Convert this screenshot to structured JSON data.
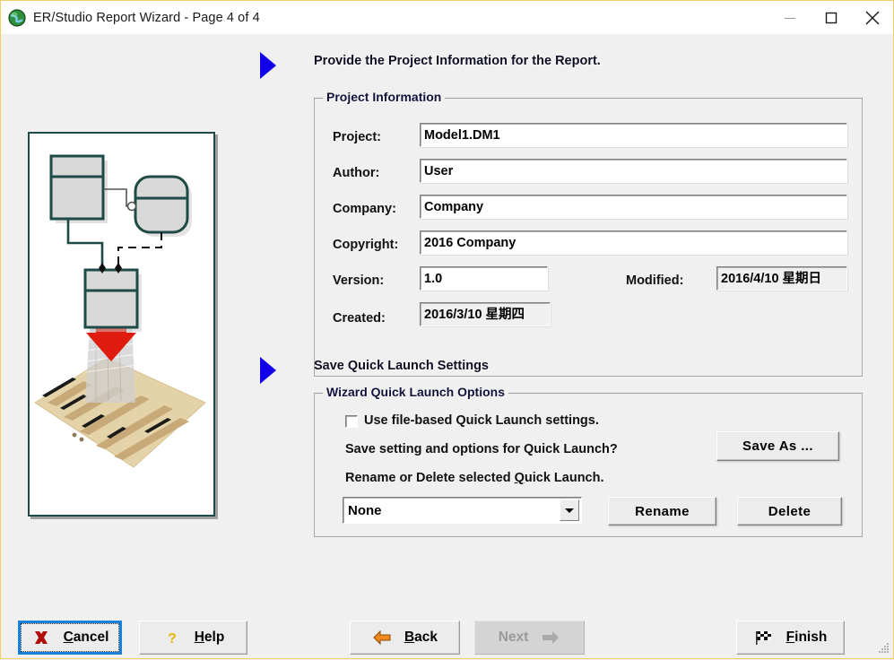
{
  "window": {
    "title": "ER/Studio Report Wizard - Page 4 of 4",
    "icon": "globe-icon",
    "minimize_label": "Minimize",
    "maximize_label": "Maximize",
    "close_label": "Close",
    "accent_border_color": "#f2cf6b",
    "titlebar_bg": "#ffffff",
    "client_bg": "#f0f0f0"
  },
  "illustration": {
    "name": "er-model-to-report-illustration",
    "colors": {
      "entity_border": "#1e4a47",
      "entity_fill": "#d5d5d5",
      "arrow": "#e02020",
      "page": "#e2ceа0"
    }
  },
  "section_project": {
    "heading": "Provide the Project Information for the Report.",
    "bullet_icon": "blue-triangle-bullet-icon",
    "group_title": "Project Information",
    "fields": [
      {
        "label": "Project:",
        "value": "Model1.DM1",
        "readonly": false
      },
      {
        "label": "Author:",
        "value": "User",
        "readonly": false
      },
      {
        "label": "Company:",
        "value": "Company",
        "readonly": false
      },
      {
        "label": "Copyright:",
        "value": "2016 Company",
        "readonly": false
      },
      {
        "label": "Version:",
        "value": "1.0",
        "readonly": false
      },
      {
        "label": "Modified:",
        "value": "2016/4/10 星期日",
        "readonly": true
      },
      {
        "label": "Created:",
        "value": "2016/3/10 星期四",
        "readonly": true
      }
    ]
  },
  "section_quicklaunch": {
    "heading": "Save Quick Launch Settings",
    "bullet_icon": "blue-triangle-bullet-icon",
    "group_title": "Wizard Quick Launch Options",
    "checkbox": {
      "label": "Use file-based Quick Launch settings.",
      "checked": false
    },
    "save_prompt": "Save setting and options for Quick Launch?",
    "save_as_button": "Save As ...",
    "rename_prompt_pre": "Rename or Delete selected ",
    "rename_prompt_accel": "Q",
    "rename_prompt_post": "uick Launch.",
    "combo": {
      "value": "None",
      "options": [
        "None"
      ]
    },
    "rename_button": "Rename",
    "delete_button": "Delete"
  },
  "footer": {
    "cancel": {
      "pre": "",
      "accel": "C",
      "post": "ancel",
      "icon": "red-x-icon",
      "state": "focused"
    },
    "help": {
      "pre": "",
      "accel": "H",
      "post": "elp",
      "icon": "question-mark-icon",
      "state": "normal"
    },
    "back": {
      "pre": "",
      "accel": "B",
      "post": "ack",
      "icon": "orange-left-arrow-icon",
      "state": "normal"
    },
    "next": {
      "pre": "",
      "accel": "x",
      "post": "",
      "text": "Next",
      "icon": "grey-right-arrow-icon",
      "state": "disabled"
    },
    "finish": {
      "pre": "",
      "accel": "F",
      "post": "inish",
      "icon": "checkered-flag-icon",
      "state": "normal"
    }
  }
}
